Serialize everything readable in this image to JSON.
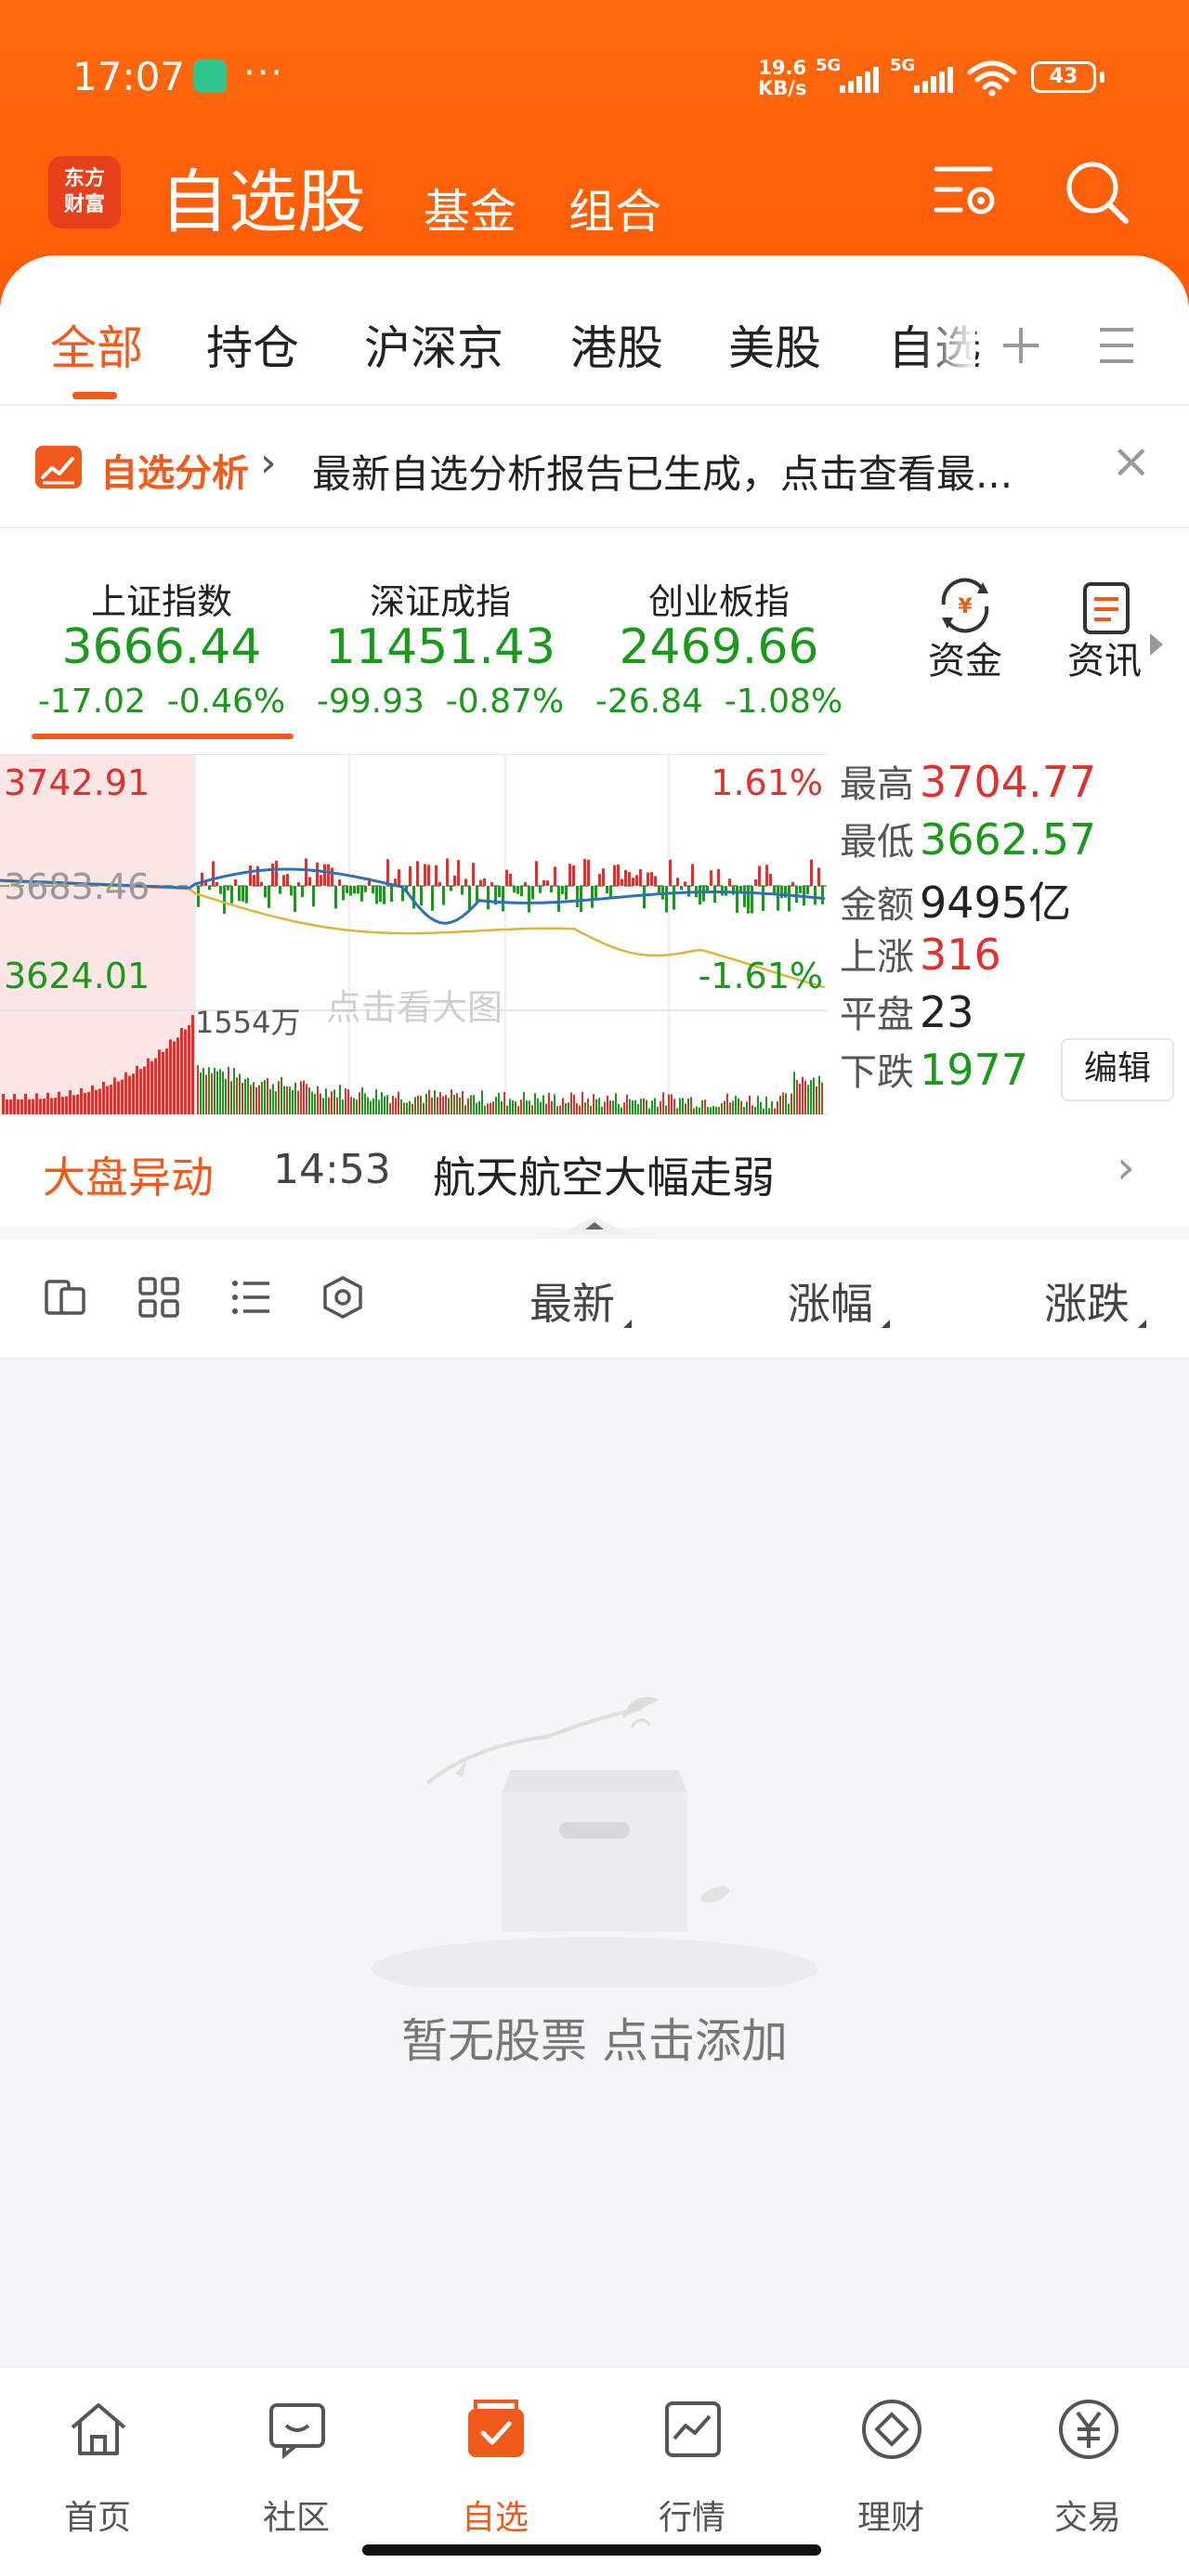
{
  "status_bar": {
    "time": "17:07",
    "more": "···",
    "net_speed_value": "19.6",
    "net_speed_unit": "KB/s",
    "signal1_label": "5G",
    "signal2_label": "5G",
    "battery": "43"
  },
  "header": {
    "logo_line1": "东方",
    "logo_line2": "财富",
    "title": "自选股",
    "tabs": [
      "基金",
      "组合"
    ],
    "icons": [
      "settings-list-icon",
      "search-icon"
    ]
  },
  "tabs": {
    "items": [
      "全部",
      "持仓",
      "沪深京",
      "港股",
      "美股",
      "自选"
    ],
    "active": "全部",
    "icons": [
      "plus-icon",
      "menu-icon"
    ]
  },
  "analysis_banner": {
    "title": "自选分析",
    "text": "最新自选分析报告已生成，点击查看最...",
    "close": "×"
  },
  "indices": [
    {
      "name": "上证指数",
      "value": "3666.44",
      "change": "-17.02",
      "pct": "-0.46%"
    },
    {
      "name": "深证成指",
      "value": "11451.43",
      "change": "-99.93",
      "pct": "-0.87%"
    },
    {
      "name": "创业板指",
      "value": "2469.66",
      "change": "-26.84",
      "pct": "-1.08%"
    }
  ],
  "index_buttons": [
    {
      "label": "资金",
      "icon": "fund-flow-icon"
    },
    {
      "label": "资讯",
      "icon": "news-icon"
    }
  ],
  "mini_chart": {
    "high_label": "3742.91",
    "mid_label": "3683.46",
    "low_label": "3624.01",
    "pct_high": "1.61%",
    "pct_low": "-1.61%",
    "volume_label": "1554万",
    "watermark": "点击看大图",
    "colors": {
      "up": "#e0312e",
      "down": "#1a9a1a",
      "line": "#2e6fb5",
      "avg": "#e0b43a"
    }
  },
  "market_stats": [
    {
      "key": "最高",
      "value": "3704.77",
      "color": "#e0312e"
    },
    {
      "key": "最低",
      "value": "3662.57",
      "color": "#1a9a1a"
    },
    {
      "key": "金额",
      "value": "9495亿",
      "color": "#222222"
    },
    {
      "key": "上涨",
      "value": "316",
      "color": "#e0312e"
    },
    {
      "key": "平盘",
      "value": "23",
      "color": "#222222"
    },
    {
      "key": "下跌",
      "value": "1977",
      "color": "#1a9a1a"
    }
  ],
  "edit_button": "编辑",
  "market_movement": {
    "label": "大盘异动",
    "time": "14:53",
    "text": "航天航空大幅走弱"
  },
  "sort_bar": {
    "view_icons": [
      "card-view-icon",
      "grid-view-icon",
      "list-view-icon",
      "settings-icon"
    ],
    "columns": [
      "最新",
      "涨幅",
      "涨跌"
    ]
  },
  "empty_state": {
    "text": "暂无股票  点击添加"
  },
  "bottom_nav": [
    {
      "label": "首页",
      "icon": "home-icon"
    },
    {
      "label": "社区",
      "icon": "community-icon"
    },
    {
      "label": "自选",
      "icon": "watchlist-icon"
    },
    {
      "label": "行情",
      "icon": "market-icon"
    },
    {
      "label": "理财",
      "icon": "wealth-icon"
    },
    {
      "label": "交易",
      "icon": "trade-icon"
    }
  ],
  "bottom_nav_active": "自选"
}
